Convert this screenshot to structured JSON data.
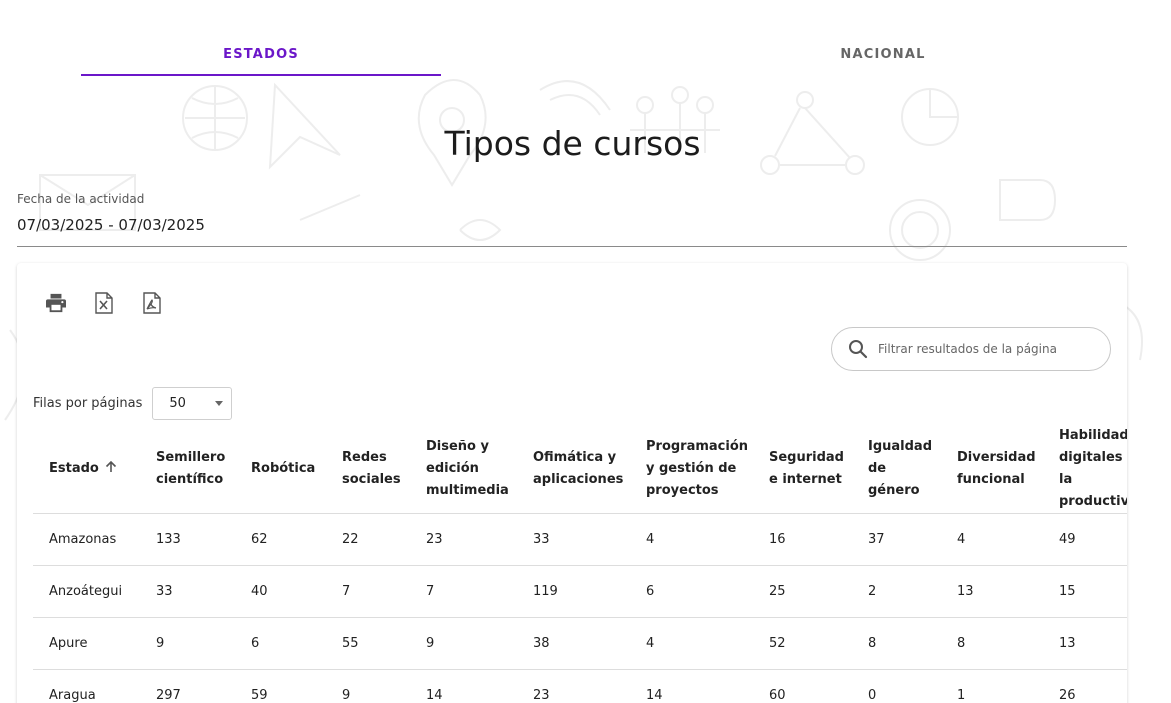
{
  "tabs": [
    {
      "label": "ESTADOS",
      "active": true
    },
    {
      "label": "NACIONAL",
      "active": false
    }
  ],
  "page_title": "Tipos de cursos",
  "date_filter": {
    "label": "Fecha de la actividad",
    "value": "07/03/2025 - 07/03/2025"
  },
  "toolbar": {
    "icons": [
      "print-icon",
      "excel-export-icon",
      "pdf-export-icon"
    ]
  },
  "search": {
    "placeholder": "Filtrar resultados de la página",
    "value": ""
  },
  "pagination": {
    "rows_label": "Filas por páginas",
    "rows_value": "50"
  },
  "table": {
    "columns": [
      "Estado",
      "Semillero científico",
      "Robótica",
      "Redes sociales",
      "Diseño y edición multimedia",
      "Ofimática y aplicaciones",
      "Programación y gestión de proyectos",
      "Seguridad e internet",
      "Igualdad de género",
      "Diversidad funcional",
      "Habilidades digitales para la productividad"
    ],
    "rows": [
      [
        "Amazonas",
        "133",
        "62",
        "22",
        "23",
        "33",
        "4",
        "16",
        "37",
        "4",
        "49"
      ],
      [
        "Anzoátegui",
        "33",
        "40",
        "7",
        "7",
        "119",
        "6",
        "25",
        "2",
        "13",
        "15"
      ],
      [
        "Apure",
        "9",
        "6",
        "55",
        "9",
        "38",
        "4",
        "52",
        "8",
        "8",
        "13"
      ],
      [
        "Aragua",
        "297",
        "59",
        "9",
        "14",
        "23",
        "14",
        "60",
        "0",
        "1",
        "26"
      ]
    ]
  },
  "colors": {
    "accent": "#6b17c9"
  }
}
